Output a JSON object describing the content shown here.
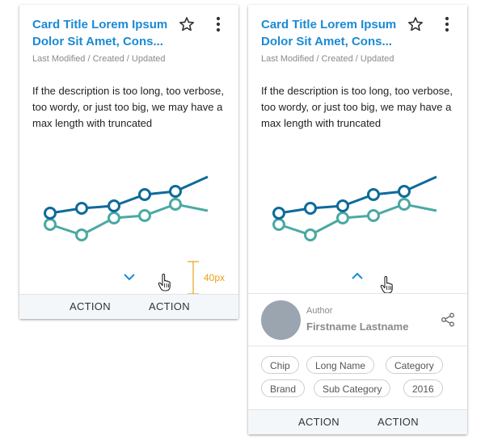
{
  "cards": {
    "collapsed": {
      "title": "Card Title Lorem Ipsum Dolor Sit Amet, Cons...",
      "meta": "Last Modified / Created / Updated",
      "description": "If the description is too long, too verbose, too wordy, or just too big, we may have a max length with truncated",
      "actions": [
        "ACTION",
        "ACTION"
      ],
      "annotation": "40px"
    },
    "expanded": {
      "title": "Card Title Lorem Ipsum Dolor Sit Amet, Cons...",
      "meta": "Last Modified / Created / Updated",
      "description": "If the description is too long, too verbose, too wordy, or just too big, we may have a max length with truncated",
      "author_label": "Author",
      "author_name": "Firstname Lastname",
      "chips": [
        "Chip",
        "Long Name",
        "Category",
        "Brand",
        "Sub Category",
        "2016"
      ],
      "actions": [
        "ACTION",
        "ACTION"
      ]
    }
  },
  "colors": {
    "title": "#1a8ad4",
    "series_dark": "#0e6a9a",
    "series_teal": "#4aa9a3",
    "annotation": "#e8a11a",
    "chevron": "#1a8ad4"
  },
  "icons": [
    "star-icon",
    "more-vert-icon",
    "chevron-down-icon",
    "chevron-up-icon",
    "hand-cursor-icon",
    "share-icon"
  ]
}
